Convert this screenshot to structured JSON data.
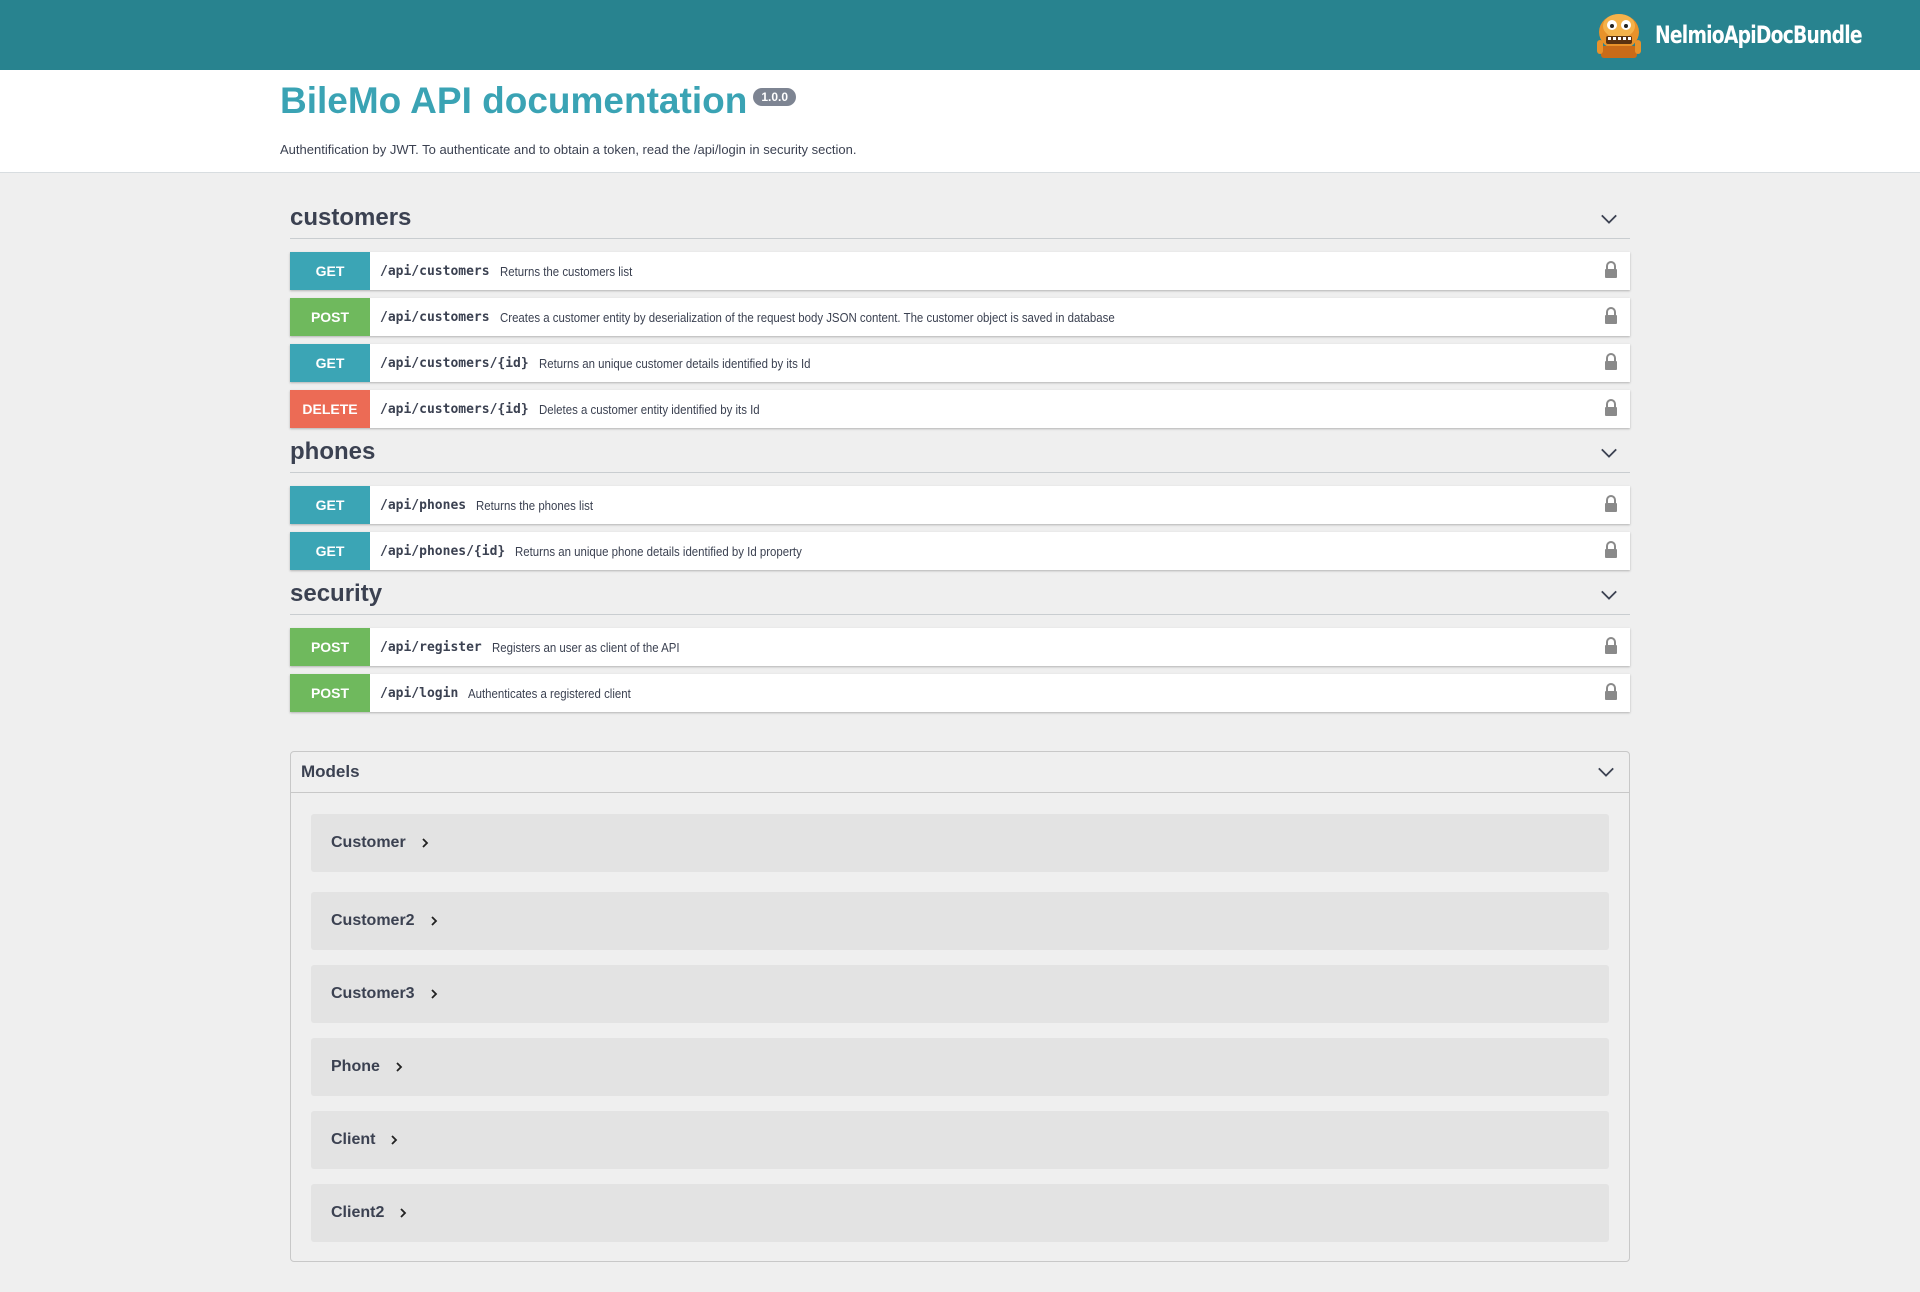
{
  "topbar": {
    "brand": "NelmioApiDocBundle",
    "logo_icon": "nelmio-mascot-icon",
    "bg": "#28838f"
  },
  "info": {
    "title": "BileMo API documentation",
    "version": "1.0.0",
    "description": "Authentification by JWT. To authenticate and to obtain a token, read the /api/login in security section."
  },
  "colors": {
    "get": "#3ba5b5",
    "post": "#6fb95d",
    "delete": "#ec6b55"
  },
  "tags": [
    {
      "name": "customers",
      "operations": [
        {
          "method": "GET",
          "path": "/api/customers",
          "summary": "Returns the customers list"
        },
        {
          "method": "POST",
          "path": "/api/customers",
          "summary": "Creates a customer entity by deserialization of the request body JSON content. The customer object is saved in database"
        },
        {
          "method": "GET",
          "path": "/api/customers/{id}",
          "summary": "Returns an unique customer details identified by its Id"
        },
        {
          "method": "DELETE",
          "path": "/api/customers/{id}",
          "summary": "Deletes a customer entity identified by its Id"
        }
      ]
    },
    {
      "name": "phones",
      "operations": [
        {
          "method": "GET",
          "path": "/api/phones",
          "summary": "Returns the phones list"
        },
        {
          "method": "GET",
          "path": "/api/phones/{id}",
          "summary": "Returns an unique phone details identified by Id property"
        }
      ]
    },
    {
      "name": "security",
      "operations": [
        {
          "method": "POST",
          "path": "/api/register",
          "summary": "Registers an user as client of the API"
        },
        {
          "method": "POST",
          "path": "/api/login",
          "summary": "Authenticates a registered client"
        }
      ]
    }
  ],
  "models": {
    "title": "Models",
    "items": [
      "Customer",
      "Customer2",
      "Customer3",
      "Phone",
      "Client",
      "Client2"
    ]
  }
}
